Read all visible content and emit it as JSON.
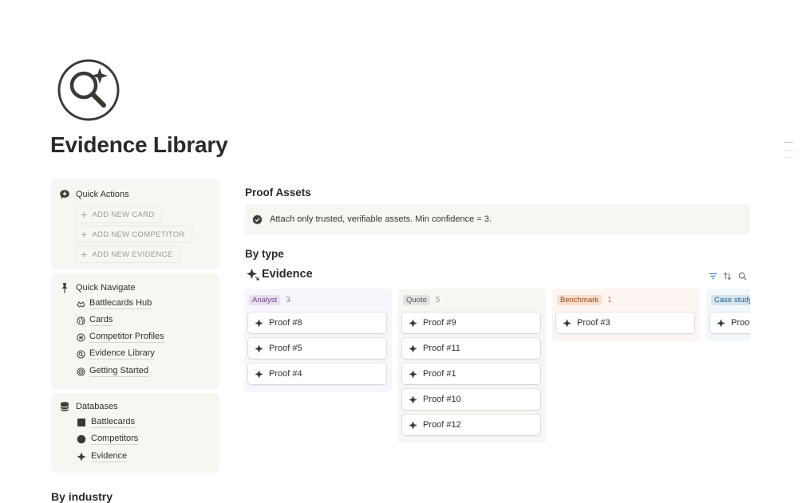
{
  "page": {
    "title": "Evidence Library",
    "icon": "magnifier-sparkle-icon"
  },
  "sidebar": {
    "quick_actions": {
      "title": "Quick Actions",
      "icon": "chat-plus-icon",
      "buttons": [
        {
          "label": "ADD NEW CARD"
        },
        {
          "label": "ADD NEW COMPETITOR"
        },
        {
          "label": "ADD NEW EVIDENCE"
        }
      ]
    },
    "quick_navigate": {
      "title": "Quick Navigate",
      "icon": "pin-icon",
      "links": [
        {
          "label": "Battlecards Hub",
          "icon": "hands-icon"
        },
        {
          "label": "Cards",
          "icon": "globe-icon"
        },
        {
          "label": "Competitor Profiles",
          "icon": "lines-icon"
        },
        {
          "label": "Evidence Library",
          "icon": "magnifier-icon"
        },
        {
          "label": "Getting Started",
          "icon": "target-icon"
        }
      ]
    },
    "databases": {
      "title": "Databases",
      "icon": "database-icon",
      "links": [
        {
          "label": "Battlecards",
          "icon": "square-icon"
        },
        {
          "label": "Competitors",
          "icon": "circle-icon"
        },
        {
          "label": "Evidence",
          "icon": "sparkle-icon"
        }
      ]
    }
  },
  "main": {
    "proof_assets": {
      "heading": "Proof Assets",
      "callout_text": "Attach only trusted, verifiable assets. Min confidence = 3."
    },
    "by_type": {
      "heading": "By type",
      "database_title": "Evidence",
      "tools": [
        "filter-icon",
        "sort-icon",
        "search-icon"
      ],
      "columns": [
        {
          "tag": "Analyst",
          "count": "3",
          "cards": [
            "Proof #8",
            "Proof #5",
            "Proof #4"
          ],
          "colors": {
            "bg": "#f8f5fc",
            "tag_bg": "#e8deee",
            "tag_fg": "#6b4a84",
            "count": "#a08ab5"
          }
        },
        {
          "tag": "Quote",
          "count": "5",
          "cards": [
            "Proof #9",
            "Proof #11",
            "Proof #1",
            "Proof #10",
            "Proof #12"
          ],
          "colors": {
            "bg": "#f7f6f3",
            "tag_bg": "#e3e2e0",
            "tag_fg": "#5a5955",
            "count": "#9b9a97"
          }
        },
        {
          "tag": "Benchmark",
          "count": "1",
          "cards": [
            "Proof #3"
          ],
          "colors": {
            "bg": "#fcf5f2",
            "tag_bg": "#fadec9",
            "tag_fg": "#8d4b25",
            "count": "#c98a66"
          }
        },
        {
          "tag": "Case study",
          "count": "",
          "cards": [
            "Proof"
          ],
          "colors": {
            "bg": "#f2f7fb",
            "tag_bg": "#d3e5ef",
            "tag_fg": "#2d5f82",
            "count": "#7fa3bd"
          }
        }
      ]
    },
    "by_industry": {
      "heading": "By industry"
    }
  }
}
